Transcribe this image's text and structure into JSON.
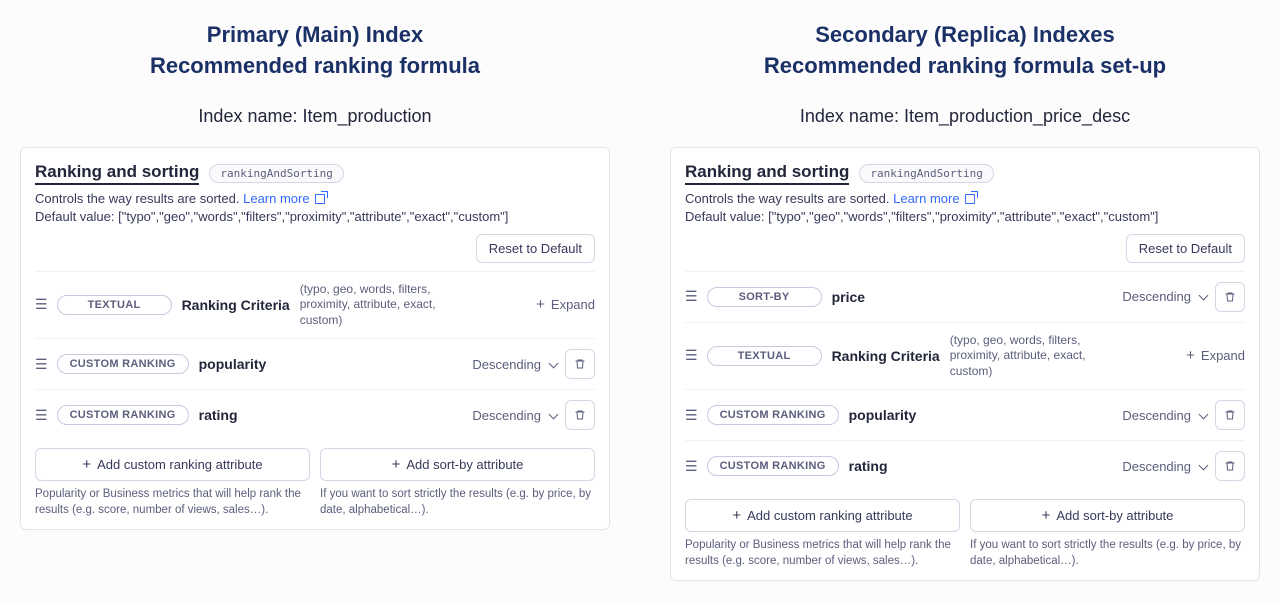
{
  "left": {
    "title_line1": "Primary (Main) Index",
    "title_line2": "Recommended ranking formula",
    "index_name": "Index name: Item_production"
  },
  "right": {
    "title_line1": "Secondary (Replica) Indexes",
    "title_line2": "Recommended ranking formula set-up",
    "index_name": "Index name: Item_production_price_desc"
  },
  "panel": {
    "title": "Ranking and sorting",
    "badge": "rankingAndSorting",
    "desc": "Controls the way results are sorted.",
    "learn_more": "Learn more",
    "default_value": "Default value: [\"typo\",\"geo\",\"words\",\"filters\",\"proximity\",\"attribute\",\"exact\",\"custom\"]",
    "reset": "Reset to Default",
    "criteria_hint": "(typo, geo, words, filters, proximity, attribute, exact, custom)",
    "expand": "Expand",
    "descending": "Descending",
    "add_custom": "Add custom ranking attribute",
    "add_sortby": "Add sort-by attribute",
    "foot1": "Popularity or Business metrics that will help rank the results (e.g. score, number of views, sales…).",
    "foot2": "If you want to sort strictly the results (e.g. by price, by date, alphabetical…)."
  },
  "tags": {
    "textual": "TEXTUAL",
    "custom_ranking": "CUSTOM RANKING",
    "sort_by": "SORT-BY"
  },
  "labels": {
    "ranking_criteria": "Ranking Criteria",
    "popularity": "popularity",
    "rating": "rating",
    "price": "price"
  }
}
